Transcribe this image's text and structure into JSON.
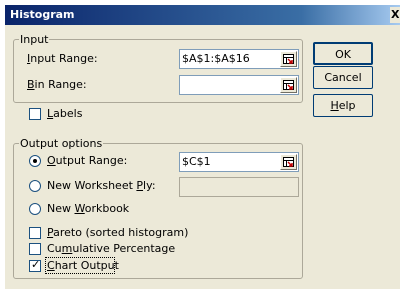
{
  "window": {
    "title": "Histogram",
    "close_glyph": "X"
  },
  "input_group": {
    "legend": "Input",
    "input_range": {
      "label_pre": "",
      "label_key": "I",
      "label_post": "nput Range:",
      "value": "$A$1:$A$16"
    },
    "bin_range": {
      "label_pre": "",
      "label_key": "B",
      "label_post": "in Range:",
      "value": ""
    }
  },
  "labels_checkbox": {
    "label_pre": "",
    "label_key": "L",
    "label_post": "abels",
    "checked": false
  },
  "output_group": {
    "legend": "Output options",
    "output_range": {
      "label_pre": "",
      "label_key": "O",
      "label_post": "utput Range:",
      "value": "$C$1",
      "selected": true
    },
    "new_worksheet_ply": {
      "label_pre": "New Worksheet ",
      "label_key": "P",
      "label_post": "ly:",
      "value": "",
      "selected": false
    },
    "new_workbook": {
      "label_pre": "New ",
      "label_key": "W",
      "label_post": "orkbook",
      "selected": false
    },
    "pareto": {
      "label_pre": "",
      "label_key": "P",
      "label_post": "areto (sorted histogram)",
      "checked": false
    },
    "cumulative": {
      "label_pre": "Cu",
      "label_key": "m",
      "label_post": "ulative Percentage",
      "checked": false
    },
    "chart_output": {
      "label_pre": "",
      "label_key": "C",
      "label_post": "hart Output",
      "checked": true
    }
  },
  "buttons": {
    "ok": "OK",
    "cancel": "Cancel",
    "help_pre": "",
    "help_key": "H",
    "help_post": "elp"
  },
  "icons": {
    "ref_icon": "range-selector-icon",
    "check_glyph": "✓"
  },
  "colors": {
    "titlebar": "#0a246a",
    "dialog_bg": "#ece9d8",
    "ref_icon_red": "#c00000"
  }
}
